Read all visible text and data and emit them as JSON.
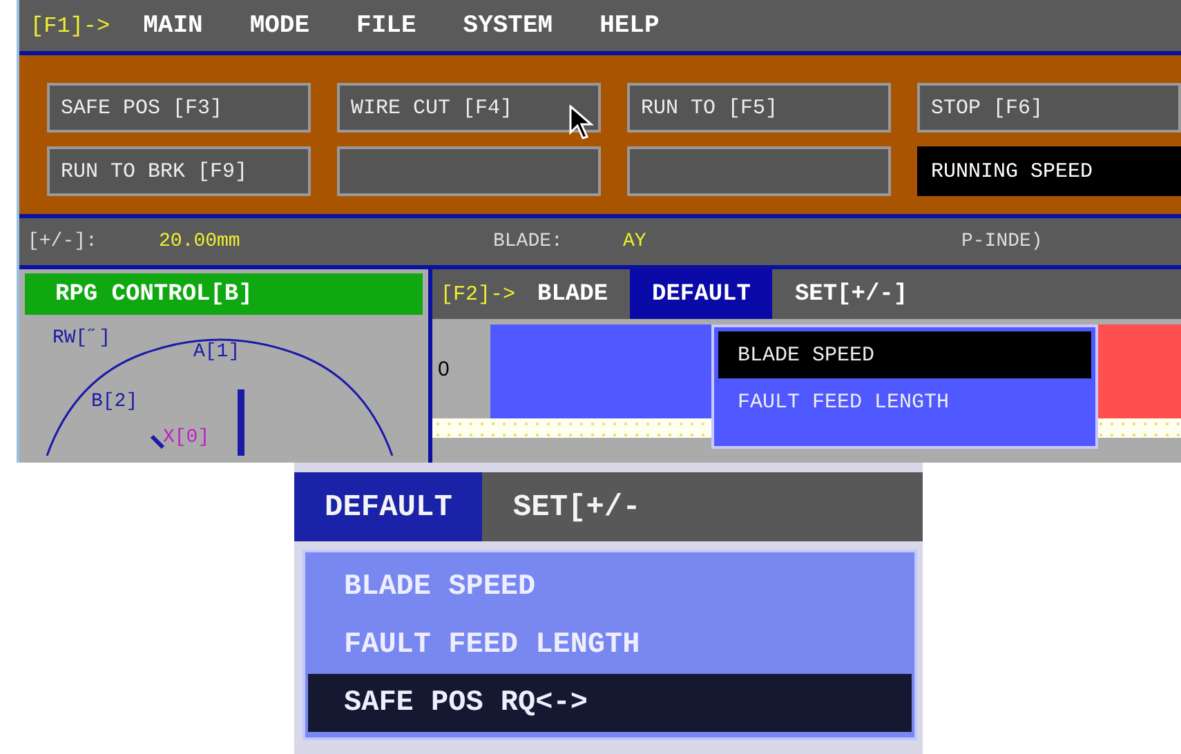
{
  "menu_bar": {
    "prefix": "[F1]->",
    "items": [
      "MAIN",
      "MODE",
      "FILE",
      "SYSTEM",
      "HELP"
    ]
  },
  "function_buttons": [
    {
      "kind": "labeled",
      "label": "SAFE POS [F3]",
      "selected": false
    },
    {
      "kind": "labeled",
      "label": "WIRE CUT [F4]",
      "selected": false
    },
    {
      "kind": "labeled",
      "label": "RUN TO [F5]",
      "selected": false
    },
    {
      "kind": "labeled",
      "label": "STOP [F6]",
      "selected": false
    },
    {
      "kind": "labeled",
      "label": "RUN TO BRK [F9]",
      "selected": false
    },
    {
      "kind": "blank",
      "selected": false
    },
    {
      "kind": "blank",
      "selected": false
    },
    {
      "kind": "labeled",
      "label": "RUNNING SPEED",
      "selected": true
    }
  ],
  "status_line": {
    "step_label": "[+/-]:",
    "step_value": "20.00mm",
    "blade_label": "BLADE:",
    "blade_value": "AY",
    "column_3": "P-INDE)"
  },
  "rpg_panel": {
    "title": "RPG CONTROL[B]",
    "dial_labels": [
      "RW[˝]",
      "A[1]",
      "B[2]",
      "X[0]"
    ]
  },
  "blade_panel": {
    "prefix": "[F2]->",
    "tabs": [
      {
        "label": "BLADE",
        "selected": false
      },
      {
        "label": "DEFAULT",
        "selected": true
      },
      {
        "label": "SET[+/-]",
        "selected": false
      }
    ],
    "row_label": "0",
    "dropdown": [
      {
        "label": "BLADE SPEED",
        "selected": true
      },
      {
        "label": "FAULT FEED LENGTH",
        "selected": false
      }
    ]
  },
  "photo_inset": {
    "tabs": [
      {
        "label": "DEFAULT",
        "selected": true
      },
      {
        "label": "SET[+/-",
        "selected": false
      }
    ],
    "dropdown": [
      {
        "label": "BLADE SPEED",
        "selected": false
      },
      {
        "label": "FAULT FEED LENGTH",
        "selected": false
      },
      {
        "label": "SAFE POS RQ<->",
        "selected": true
      }
    ]
  }
}
